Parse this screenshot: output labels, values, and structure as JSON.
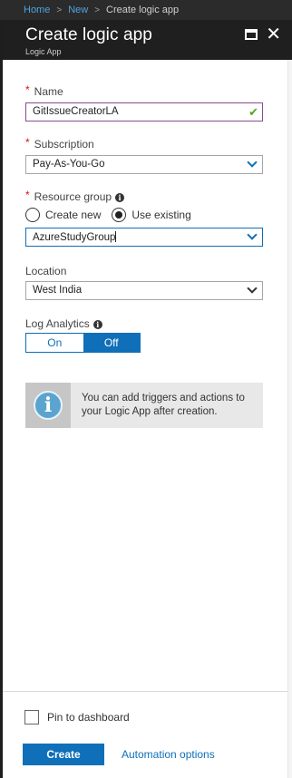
{
  "breadcrumb": {
    "items": [
      "Home",
      "New",
      "Create logic app"
    ],
    "separator": ">"
  },
  "header": {
    "title": "Create logic app",
    "subtitle": "Logic App",
    "maximize_icon": "maximize-icon",
    "close_icon": "close-icon",
    "close_glyph": "✕"
  },
  "form": {
    "required_marker": "*",
    "name": {
      "label": "Name",
      "value": "GitIssueCreatorLA",
      "valid_icon": "check-icon",
      "valid_glyph": "✔"
    },
    "subscription": {
      "label": "Subscription",
      "value": "Pay-As-You-Go"
    },
    "resource_group": {
      "label": "Resource group",
      "info_glyph": "i",
      "options": [
        "Create new",
        "Use existing"
      ],
      "selected": "Use existing",
      "value": "AzureStudyGroup"
    },
    "location": {
      "label": "Location",
      "value": "West India"
    },
    "log_analytics": {
      "label": "Log Analytics",
      "info_glyph": "i",
      "options": [
        "On",
        "Off"
      ],
      "selected": "Off"
    }
  },
  "infobox": {
    "icon_glyph": "i",
    "message": "You can add triggers and actions to your Logic App after creation."
  },
  "footer": {
    "pin_label": "Pin to dashboard",
    "pin_checked": false,
    "create_label": "Create",
    "automation_label": "Automation options"
  },
  "colors": {
    "accent": "#0f6fb8",
    "header_bg": "#1f1f1f",
    "required": "#e00b1c",
    "valid_check": "#58a11d",
    "info_icon": "#5aa4cf"
  }
}
